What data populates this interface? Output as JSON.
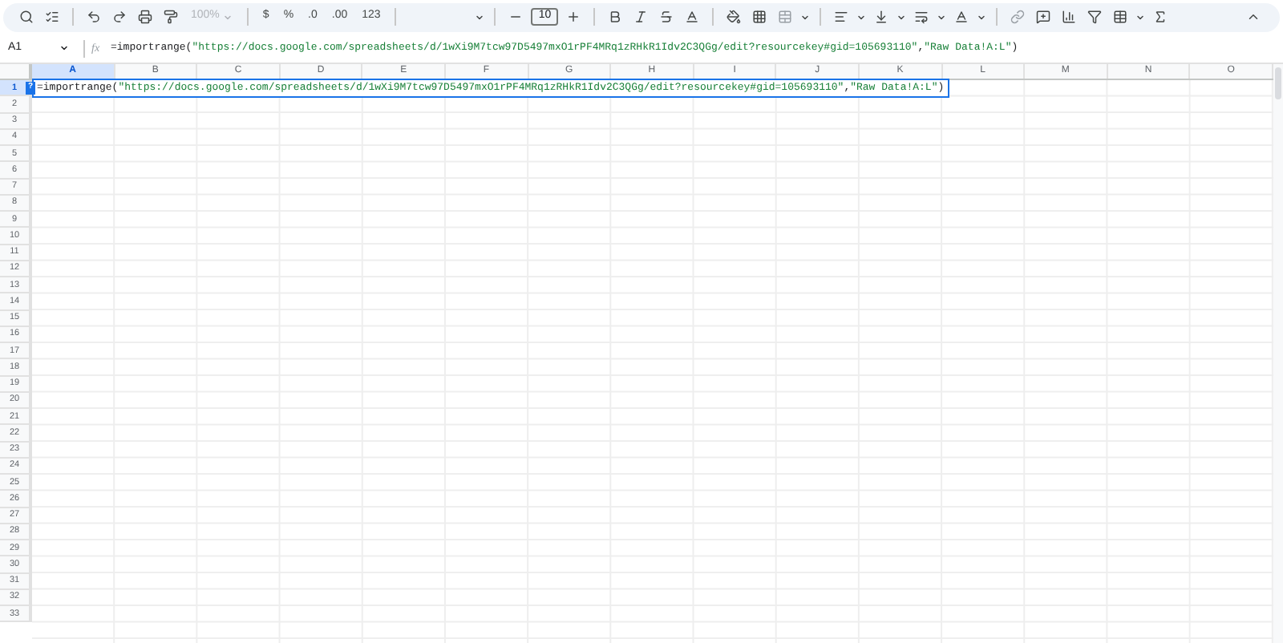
{
  "toolbar": {
    "zoom": {
      "label": "100%",
      "disabled": true
    },
    "currency": "$",
    "percent": "%",
    "decrease_decimal": ".0",
    "increase_decimal": ".00",
    "number_format": "123",
    "font_size": "10"
  },
  "formula_bar": {
    "name_box": "A1",
    "fx": "fx",
    "formula": [
      {
        "kind": "plain",
        "text": "=importrange("
      },
      {
        "kind": "string",
        "text": "\"https://docs.google.com/spreadsheets/d/1wXi9M7tcw97D5497mxO1rPF4MRq1zRHkR1Idv2C3QGg/edit?resourcekey#gid=105693110\""
      },
      {
        "kind": "plain",
        "text": ","
      },
      {
        "kind": "string",
        "text": "\"Raw Data!A:L\""
      },
      {
        "kind": "plain",
        "text": ")"
      }
    ]
  },
  "grid": {
    "columns": [
      {
        "label": "A",
        "selected": true
      },
      {
        "label": "B",
        "selected": false
      },
      {
        "label": "C",
        "selected": false
      },
      {
        "label": "D",
        "selected": false
      },
      {
        "label": "E",
        "selected": false
      },
      {
        "label": "F",
        "selected": false
      },
      {
        "label": "G",
        "selected": false
      },
      {
        "label": "H",
        "selected": false
      },
      {
        "label": "I",
        "selected": false
      },
      {
        "label": "J",
        "selected": false
      },
      {
        "label": "K",
        "selected": false
      },
      {
        "label": "L",
        "selected": false
      },
      {
        "label": "M",
        "selected": false
      },
      {
        "label": "N",
        "selected": false
      },
      {
        "label": "O",
        "selected": false
      }
    ],
    "rows": [
      {
        "label": "1",
        "selected": true
      },
      {
        "label": "2",
        "selected": false
      },
      {
        "label": "3",
        "selected": false
      },
      {
        "label": "4",
        "selected": false
      },
      {
        "label": "5",
        "selected": false
      },
      {
        "label": "6",
        "selected": false
      },
      {
        "label": "7",
        "selected": false
      },
      {
        "label": "8",
        "selected": false
      },
      {
        "label": "9",
        "selected": false
      },
      {
        "label": "10",
        "selected": false
      },
      {
        "label": "11",
        "selected": false
      },
      {
        "label": "12",
        "selected": false
      },
      {
        "label": "13",
        "selected": false
      },
      {
        "label": "14",
        "selected": false
      },
      {
        "label": "15",
        "selected": false
      },
      {
        "label": "16",
        "selected": false
      },
      {
        "label": "17",
        "selected": false
      },
      {
        "label": "18",
        "selected": false
      },
      {
        "label": "19",
        "selected": false
      },
      {
        "label": "20",
        "selected": false
      },
      {
        "label": "21",
        "selected": false
      },
      {
        "label": "22",
        "selected": false
      },
      {
        "label": "23",
        "selected": false
      },
      {
        "label": "24",
        "selected": false
      },
      {
        "label": "25",
        "selected": false
      },
      {
        "label": "26",
        "selected": false
      },
      {
        "label": "27",
        "selected": false
      },
      {
        "label": "28",
        "selected": false
      },
      {
        "label": "29",
        "selected": false
      },
      {
        "label": "30",
        "selected": false
      },
      {
        "label": "31",
        "selected": false
      },
      {
        "label": "32",
        "selected": false
      },
      {
        "label": "33",
        "selected": false
      }
    ],
    "editor": {
      "help_badge": "?",
      "formula": [
        {
          "kind": "plain",
          "text": "=importrange("
        },
        {
          "kind": "string",
          "text": "\"https://docs.google.com/spreadsheets/d/1wXi9M7tcw97D5497mxO1rPF4MRq1zRHkR1Idv2C3QGg/edit?resourcekey#gid=105693110\""
        },
        {
          "kind": "plain",
          "text": ","
        },
        {
          "kind": "string",
          "text": "\"Raw Data!A:L\""
        },
        {
          "kind": "plain",
          "text": ")"
        }
      ]
    }
  }
}
